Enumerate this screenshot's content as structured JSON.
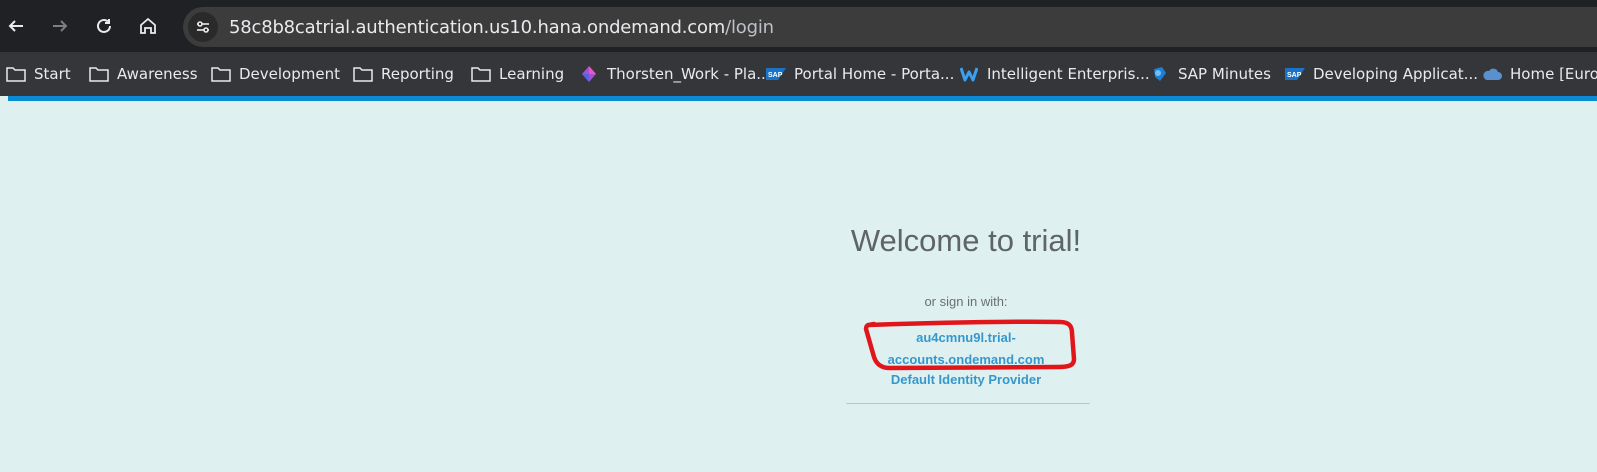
{
  "browser": {
    "url_host": "58c8b8catrial.authentication.us10.hana.ondemand.com",
    "url_path": "/login",
    "nav": {
      "back_icon": "arrow-left-icon",
      "forward_icon": "arrow-right-icon",
      "reload_icon": "reload-icon",
      "home_icon": "home-icon"
    }
  },
  "bookmarks": [
    {
      "label": "Start",
      "icon": "folder-icon"
    },
    {
      "label": "Awareness",
      "icon": "folder-icon"
    },
    {
      "label": "Development",
      "icon": "folder-icon"
    },
    {
      "label": "Reporting",
      "icon": "folder-icon"
    },
    {
      "label": "Learning",
      "icon": "folder-icon"
    },
    {
      "label": "Thorsten_Work - Pla...",
      "icon": "planner-icon"
    },
    {
      "label": "Portal Home - Porta...",
      "icon": "sap-logo-icon"
    },
    {
      "label": "Intelligent Enterpris...",
      "icon": "w-logo-icon"
    },
    {
      "label": "SAP Minutes",
      "icon": "minutes-icon"
    },
    {
      "label": "Developing Applicat...",
      "icon": "sap-logo-icon"
    },
    {
      "label": "Home [Europ",
      "icon": "cloud-icon"
    }
  ],
  "login": {
    "title": "Welcome to trial!",
    "subtitle": "or sign in with:",
    "idp_line1": "au4cmnu9l.trial-",
    "idp_line2": "accounts.ondemand.com",
    "idp_name": "Default Identity Provider"
  },
  "colors": {
    "accent": "#0a8ad4",
    "link": "#3598cc",
    "annotation": "#e0161b",
    "page_bg": "#dff0f1"
  }
}
